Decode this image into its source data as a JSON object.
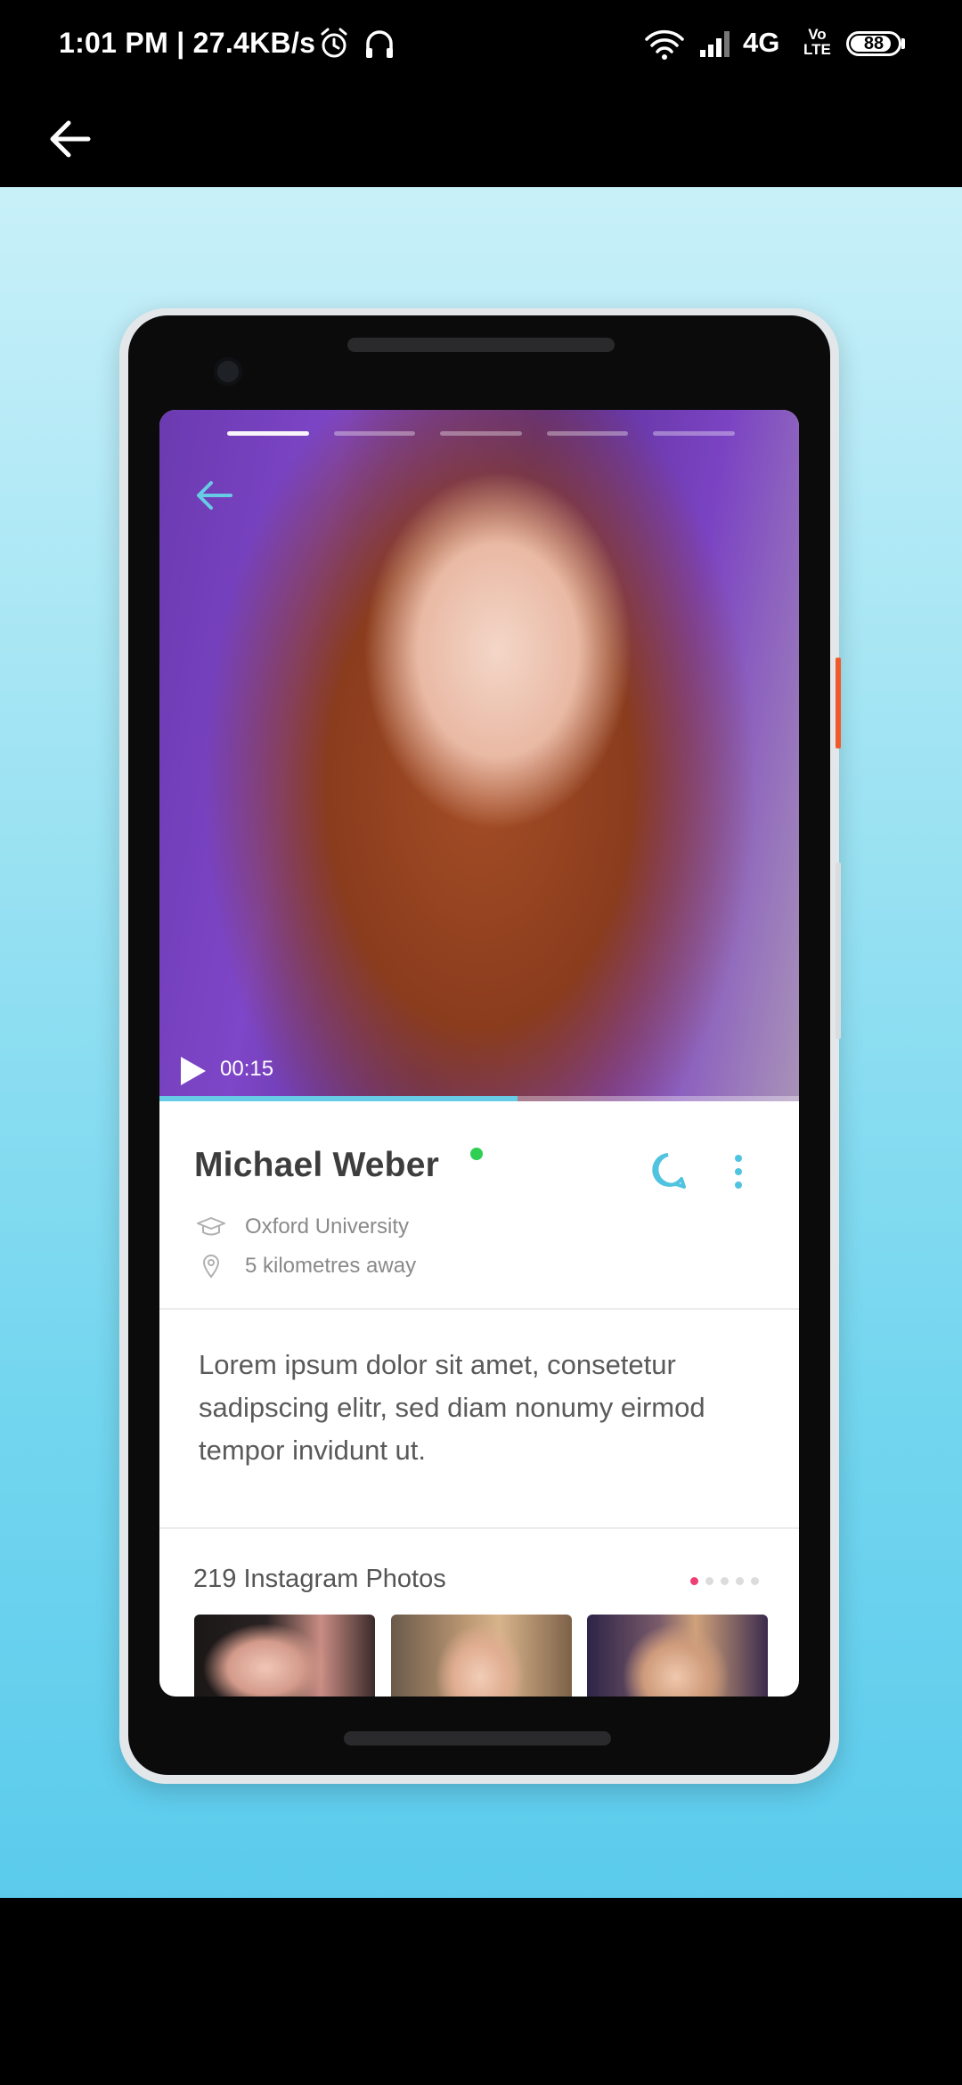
{
  "status_bar": {
    "time": "1:01 PM | 27.4KB/s",
    "network_type": "4G",
    "volte_line1": "Vo",
    "volte_line2": "LTE",
    "battery_level": "88"
  },
  "app_bar": {
    "back_icon": "arrow-left-icon"
  },
  "mockup": {
    "video": {
      "timecode": "00:15",
      "progress": 0.56,
      "story_segments": 5,
      "active_segment": 1
    },
    "profile": {
      "name": "Michael Weber",
      "online": true,
      "education": "Oxford University",
      "distance": "5 kilometres away"
    },
    "bio": "Lorem ipsum dolor sit amet, consetetur sadipscing elitr, sed diam nonumy eirmod tempor invidunt ut.",
    "instagram": {
      "title": "219 Instagram Photos",
      "pages": 5,
      "active_page": 1
    }
  },
  "colors": {
    "accent": "#67cbe6",
    "online": "#2fcf53",
    "pager_active": "#ef3e74",
    "background_top": "#c8f0f9",
    "background_bottom": "#5bcbec"
  }
}
